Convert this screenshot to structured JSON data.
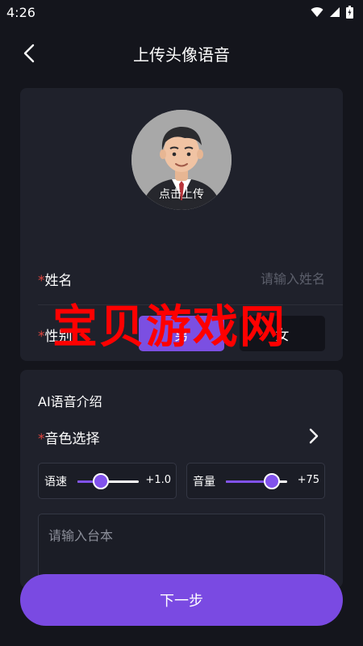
{
  "status_bar": {
    "time": "4:26"
  },
  "header": {
    "title": "上传头像语音"
  },
  "profile": {
    "avatar_label": "点击上传",
    "required_mark": "*",
    "name_label": "姓名",
    "name_placeholder": "请输入姓名",
    "gender_label": "性别",
    "gender_options": [
      "男",
      "女"
    ],
    "gender_selected": "男"
  },
  "voice": {
    "section_title": "AI语音介绍",
    "required_mark": "*",
    "timbre_label": "音色选择",
    "speed": {
      "label": "语速",
      "value_text": "+1.0",
      "level": 0.38
    },
    "volume": {
      "label": "音量",
      "value_text": "+75",
      "level": 0.75
    },
    "script_placeholder": "请输入台本"
  },
  "footer": {
    "next_label": "下一步"
  },
  "watermark": "宝贝游戏网",
  "colors": {
    "accent": "#7b4fe2",
    "background": "#14151c",
    "card": "#1f212b",
    "required": "#e0453e"
  }
}
